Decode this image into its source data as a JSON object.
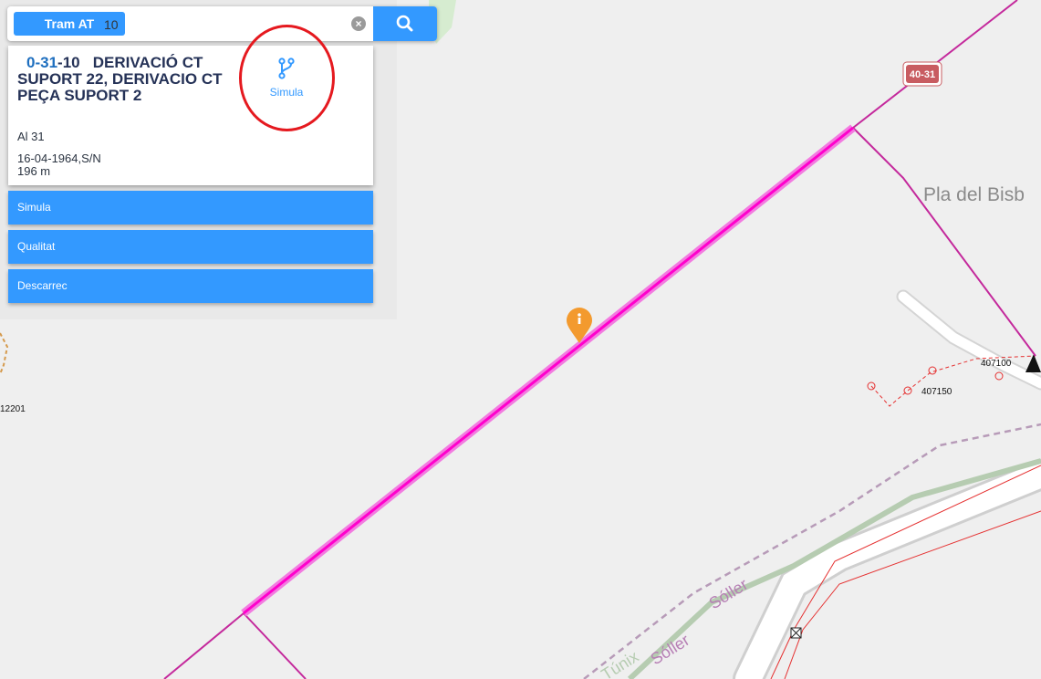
{
  "search": {
    "layer_button": "Tram AT",
    "query": "10",
    "clear_icon": "clear-icon",
    "search_icon": "search-icon"
  },
  "result": {
    "code_prefix": "0-31",
    "code_suffix": "-10",
    "title_rest": "DERIVACIÓ CT SUPORT 22, DERIVACIO CT PEÇA SUPORT 2",
    "conductor": "Al 31",
    "date_owner": "16-04-1964,S/N",
    "length": "196 m",
    "simula_icon": "branch-icon",
    "simula_label": "Simula"
  },
  "actions": [
    "Simula",
    "Qualitat",
    "Descarrec"
  ],
  "map": {
    "place_name": "Pla del Bisb",
    "line_badge": "40-31",
    "point_labels": [
      "407100",
      "407150",
      "12201"
    ],
    "road_labels": [
      "Sóller",
      "Sóller",
      "Túnix"
    ],
    "marker_icon": "info-marker-icon",
    "colors": {
      "mv_line": "#c4299c",
      "selected_line": "#ff00cc",
      "selected_halo": "#f27be0",
      "lv_line": "#e53030",
      "badge": "#c85c61",
      "button": "#3399ff",
      "marker": "#f39a2e"
    }
  }
}
